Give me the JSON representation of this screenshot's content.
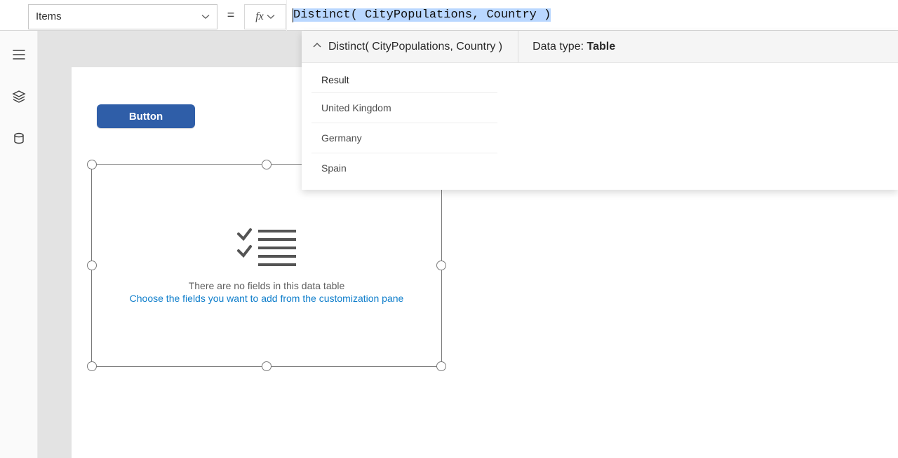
{
  "formula_bar": {
    "property": "Items",
    "equals": "=",
    "fx_label": "fx",
    "formula_tokens": {
      "t1": "Distinct(",
      "t2": " CityPopulations",
      "t3": ",",
      "t4": " Country ",
      "t5": ")"
    }
  },
  "rail_icons": {
    "hamburger": "hamburger-icon",
    "layers": "layers-icon",
    "data": "data-icon"
  },
  "button": {
    "label": "Button"
  },
  "datatable": {
    "no_fields_msg": "There are no fields in this data table",
    "choose_fields_msg": "Choose the fields you want to add from the customization pane"
  },
  "result_panel": {
    "expression": "Distinct( CityPopulations, Country )",
    "datatype_label": "Data type:",
    "datatype_value": "Table",
    "column_header": "Result",
    "rows": [
      "United Kingdom",
      "Germany",
      "Spain"
    ]
  }
}
